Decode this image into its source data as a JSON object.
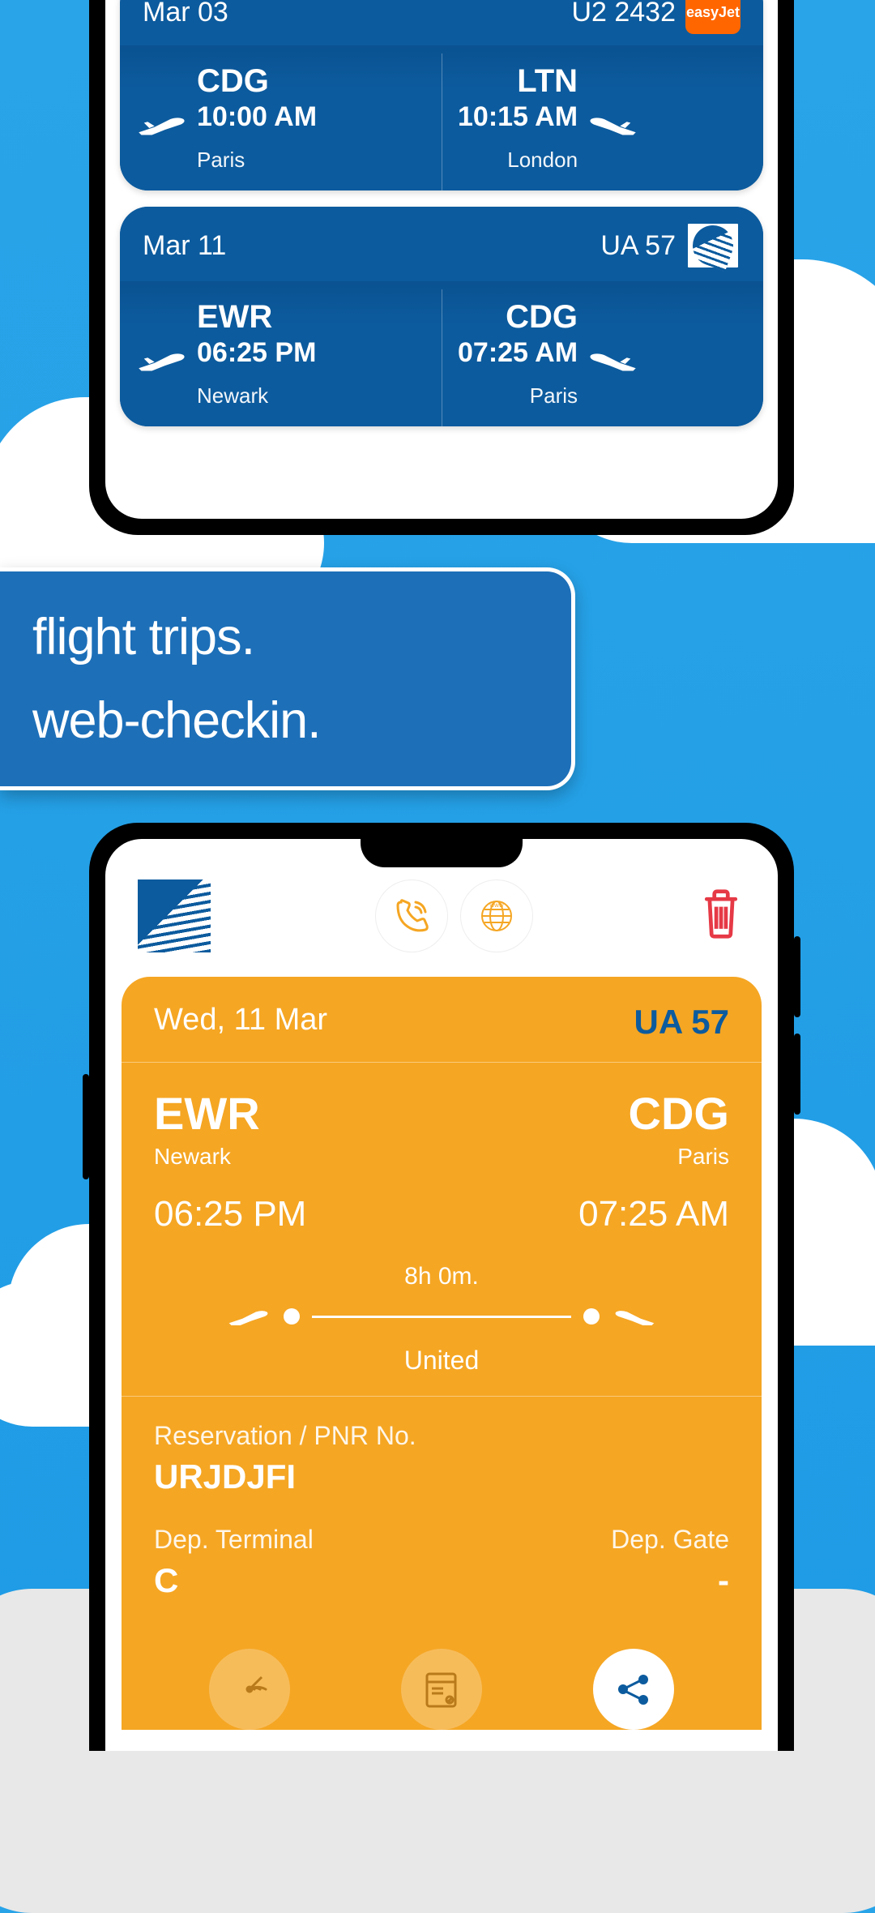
{
  "cards": [
    {
      "date": "Mar 03",
      "flight": "U2 2432",
      "airline": "easyJet",
      "airline_label": "easyJet",
      "dep_code": "CDG",
      "dep_time": "10:00 AM",
      "dep_city": "Paris",
      "arr_code": "LTN",
      "arr_time": "10:15 AM",
      "arr_city": "London"
    },
    {
      "date": "Mar 11",
      "flight": "UA 57",
      "airline": "united",
      "dep_code": "EWR",
      "dep_time": "06:25 PM",
      "dep_city": "Newark",
      "arr_code": "CDG",
      "arr_time": "07:25 AM",
      "arr_city": "Paris"
    }
  ],
  "promo": {
    "line1": "flight trips.",
    "line2": "web-checkin."
  },
  "detail": {
    "date": "Wed, 11 Mar",
    "flight": "UA 57",
    "dep_code": "EWR",
    "dep_city": "Newark",
    "dep_time": "06:25 PM",
    "arr_code": "CDG",
    "arr_city": "Paris",
    "arr_time": "07:25 AM",
    "duration": "8h 0m.",
    "airline": "United",
    "res_label": "Reservation / PNR No.",
    "pnr": "URJDJFI",
    "dep_term_label": "Dep. Terminal",
    "dep_term": "C",
    "dep_gate_label": "Dep. Gate",
    "dep_gate": "-"
  }
}
